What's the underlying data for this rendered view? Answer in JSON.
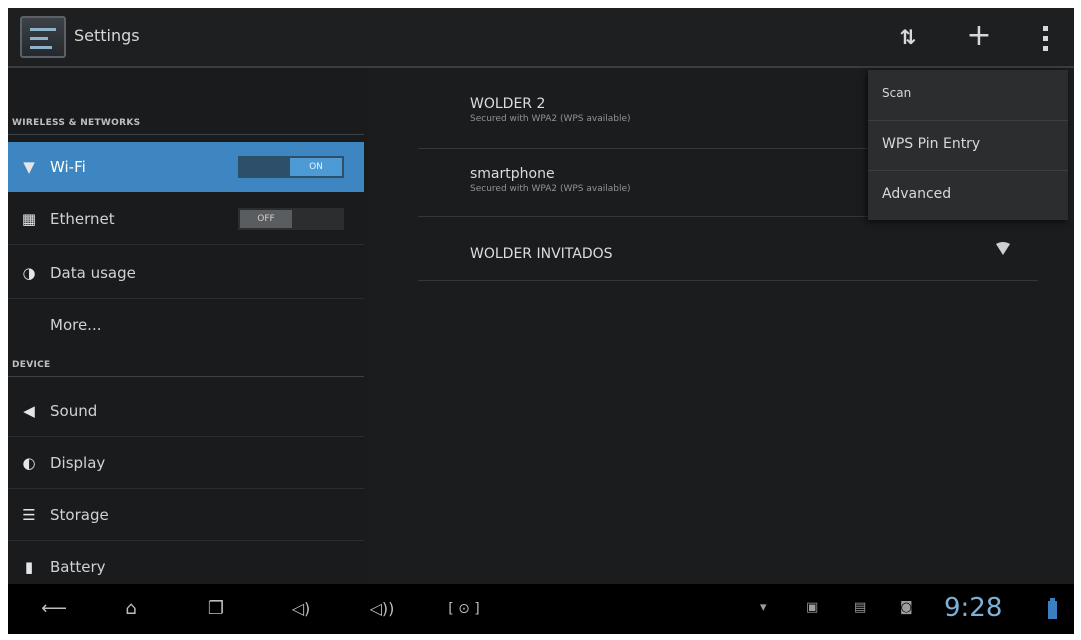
{
  "header": {
    "title": "Settings",
    "sync_icon": "sync-icon",
    "add_icon": "add-icon",
    "more_icon": "overflow-icon"
  },
  "sidebar": {
    "wireless_header": "WIRELESS & NETWORKS",
    "device_header": "DEVICE",
    "items": [
      {
        "label": "Wi-Fi",
        "toggle": "ON",
        "active": true
      },
      {
        "label": "Ethernet",
        "toggle": "OFF"
      },
      {
        "label": "Data usage"
      },
      {
        "label": "More..."
      },
      {
        "label": "Sound"
      },
      {
        "label": "Display"
      },
      {
        "label": "Storage"
      },
      {
        "label": "Battery"
      }
    ]
  },
  "networks": [
    {
      "ssid": "WOLDER 2",
      "status": "Secured with WPA2 (WPS available)"
    },
    {
      "ssid": "smartphone",
      "status": "Secured with WPA2 (WPS available)"
    },
    {
      "ssid": "WOLDER INVITADOS",
      "status": ""
    }
  ],
  "menu": {
    "items": [
      "Scan",
      "WPS Pin Entry",
      "Advanced"
    ]
  },
  "statusbar": {
    "time": "9:28"
  },
  "colors": {
    "accent": "#3d86c1",
    "background": "#1b1c1e",
    "clock": "#7fb0d6"
  }
}
